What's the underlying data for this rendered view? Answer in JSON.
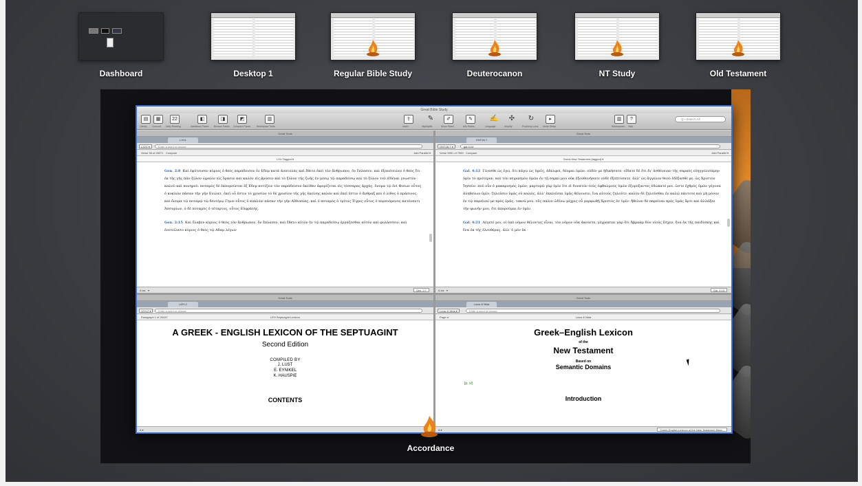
{
  "spaces": [
    {
      "label": "Dashboard"
    },
    {
      "label": "Desktop 1"
    },
    {
      "label": "Regular Bible Study"
    },
    {
      "label": "Deuterocanon"
    },
    {
      "label": "NT Study"
    },
    {
      "label": "Old Testament"
    }
  ],
  "app": {
    "name": "Accordance",
    "window_title": "Great Bible Study",
    "search_placeholder": "Q~ Search All",
    "upper_left": {
      "tab": "LXX1",
      "header": "Great Texts",
      "module": "LXX1 ▾",
      "placeholder": "Enter a word or phrase",
      "verse_info": "Verse 38 of 28071",
      "compare": "Compare",
      "add_parallel": "Add Parallel ▾",
      "title": "LXX Tagged ▾",
      "ref1": "Gen. 2:8",
      "text1": "Καὶ ἐφύτευσεν κύριος ὁ θεὸς παράδεισον ἐν Εδεμ κατὰ ἀνατολὰς καὶ ἔθετο ἐκεῖ τὸν ἄνθρωπον, ὃν ἔπλασεν. καὶ ἐξανέτειλεν ὁ θεὸς ἔτι ἐκ τῆς γῆς πᾶν ξύλον ὡραῖον εἰς ὅρασιν καὶ καλὸν εἰς βρῶσιν καὶ τὸ ξύλον τῆς ζωῆς ἐν μέσῳ τῷ παραδείσῳ καὶ τὸ ξύλον τοῦ εἰδέναι γνωστὸν καλοῦ καὶ πονηροῦ. ποταμὸς δὲ ἐκπορεύεται ἐξ Εδεμ ποτίζειν τὸν παράδεισον ἐκεῖθεν ἀφορίζεται εἰς τέσσαρας ἀρχάς. ὄνομα τῷ ἑνὶ Φισων οὗτος ὁ κυκλῶν πᾶσαν τὴν γῆν Ευιλατ, ἐκεῖ οὗ ἐστιν τὸ χρυσίον τὸ δὲ χρυσίον τῆς γῆς ἐκείνης καλόν καὶ ἐκεῖ ἐστιν ὁ ἄνθραξ καὶ ὁ λίθος ὁ πράσινος. καὶ ὄνομα τῷ ποταμῷ τῷ δευτέρῳ Γηων οὗτος ὁ κυκλῶν πᾶσαν τὴν γῆν Αἰθιοπίας. καὶ ὁ ποταμὸς ὁ τρίτος Τίγρις οὗτος ὁ πορευόμενος κατέναντι Ἀσσυρίων. ὁ δὲ ποταμὸς ὁ τέταρτος, οὗτος Εὐφράτης.",
      "ref2": "Gen. 2:15",
      "text2": "Καὶ ἔλαβεν κύριος ὁ θεὸς τὸν ἄνθρωπον, ὃν ἔπλασεν, καὶ ἔθετο αὐτὸν ἐν τῷ παραδείσῳ ἐργάζεσθαι αὐτὸν καὶ φυλάσσειν. καὶ ἐνετείλατο κύριος ὁ θεὸς τῷ Αδαμ λέγων",
      "location": "Gen. 2:7"
    },
    "upper_right": {
      "tab": "GNT28-T",
      "module": "GNT28-T ▾",
      "query": "gal 4:14",
      "verse_info": "Verse 5951 of 7969",
      "compare": "Compare",
      "add_parallel": "Add Parallel ▾",
      "title": "Greek New Testament (tagged) ▾",
      "ref1": "Gal. 4:12",
      "text1": "Γίνεσθε ὡς ἐγώ, ὅτι κἀγὼ ὡς ὑμεῖς, ἀδελφοί, δέομαι ὑμῶν. οὐδέν με ἠδικήσατε· οἴδατε δὲ ὅτι δι' ἀσθένειαν τῆς σαρκὸς εὐηγγελισάμην ὑμῖν τὸ πρότερον, καὶ τὸν πειρασμὸν ὑμῶν ἐν τῇ σαρκί μου οὐκ ἐξουθενήσατε οὐδὲ ἐξεπτύσατε, ἀλλ' ὡς ἄγγελον θεοῦ ἐδέξασθέ με, ὡς Χριστὸν Ἰησοῦν. ποῦ οὖν ὁ μακαρισμὸς ὑμῶν; μαρτυρῶ γὰρ ὑμῖν ὅτι εἰ δυνατὸν τοὺς ὀφθαλμοὺς ὑμῶν ἐξορύξαντες ἐδώκατέ μοι. ὥστε ἐχθρὸς ὑμῶν γέγονα ἀληθεύων ὑμῖν; ζηλοῦσιν ὑμᾶς οὐ καλῶς, ἀλλ' ἐκκλεῖσαι ὑμᾶς θέλουσιν, ἵνα αὐτοὺς ζηλοῦτε· καλὸν δὲ ζηλοῦσθαι ἐν καλῷ πάντοτε καὶ μὴ μόνον ἐν τῷ παρεῖναί με πρὸς ὑμᾶς. τεκνά μου, οὓς πάλιν ὠδίνω μέχρις οὗ μορφωθῇ Χριστὸς ἐν ὑμῖν· ἤθελον δὲ παρεῖναι πρὸς ὑμᾶς ἄρτι καὶ ἀλλάξαι τὴν φωνήν μου, ὅτι ἀποροῦμαι ἐν ὑμῖν.",
      "ref2": "Gal. 4:21",
      "text2": "Λέγετέ μοι, οἱ ὑπὸ νόμον θέλοντες εἶναι, τὸν νόμον οὐκ ἀκούετε; γέγραπται γὰρ ὅτι Ἀβραὰμ δύο υἱοὺς ἔσχεν, ἕνα ἐκ τῆς παιδίσκης καὶ ἕνα ἐκ τῆς ἐλευθέρας. ἀλλ' ὁ μὲν ἐκ",
      "location": "Gal. 4:13"
    },
    "lower_left": {
      "tab": "LEH-2",
      "header": "Great Tools",
      "module": "LEH-2 ▾",
      "placeholder": "Enter a word or phrase",
      "para_info": "Paragraph 1 of 20437",
      "title": "LEH Septuagint Lexicon",
      "heading": "A GREEK - ENGLISH LEXICON OF THE SEPTUAGINT",
      "edition": "Second Edition",
      "compiled": "COMPILED BY",
      "authors": [
        "J. LUST",
        "E. EYNIKEL",
        "K. HAUSPIE"
      ],
      "contents": "CONTENTS"
    },
    "lower_right": {
      "tab": "Louw & Nida",
      "module": "Louw & Nida ▾",
      "placeholder": "Enter a word or phrase",
      "page_info": "Page vi",
      "title": "Louw & Nida",
      "heading": "Greek–English Lexicon",
      "of_the": "of the",
      "nt": "New Testament",
      "based_on": "Based on",
      "domains": "Semantic Domains",
      "page_ref": "[p. vi]",
      "intro": "Introduction",
      "status": "Greek-English Lexicon of the New Testament Base..."
    },
    "toolbar_labels": [
      "Library",
      "Concord",
      "Daily Reading",
      "Interlinear Panes",
      "Browse Panes",
      "Compare Panes",
      "Workspace Tools",
      "Insert",
      "Highlights",
      "Show Panel",
      "Info Panes",
      "Language",
      "Amplify",
      "Prophecy Lens",
      "Mode Setup",
      "Workspaces",
      "Help"
    ]
  }
}
